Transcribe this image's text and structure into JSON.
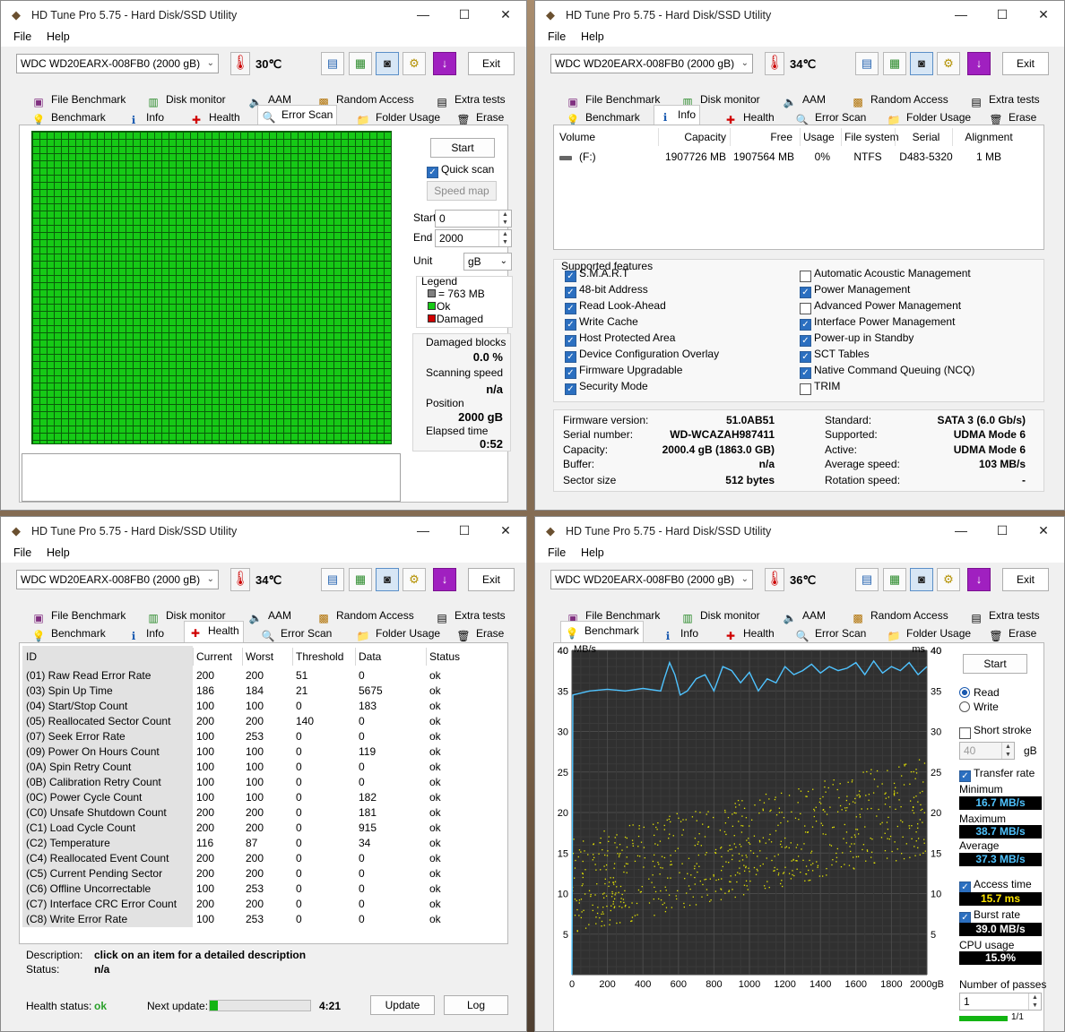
{
  "app": {
    "title": "HD Tune Pro 5.75 - Hard Disk/SSD Utility",
    "menu_file": "File",
    "menu_help": "Help",
    "exit_label": "Exit",
    "min": "—",
    "max": "☐",
    "close": "✕"
  },
  "drive": "WDC WD20EARX-008FB0 (2000 gB)",
  "temps": {
    "w1": "30℃",
    "w2": "34℃",
    "w3": "34℃",
    "w4": "36℃"
  },
  "tabs": {
    "file_benchmark": "File Benchmark",
    "disk_monitor": "Disk monitor",
    "aam": "AAM",
    "random_access": "Random Access",
    "extra_tests": "Extra tests",
    "benchmark": "Benchmark",
    "info": "Info",
    "health": "Health",
    "error_scan": "Error Scan",
    "folder_usage": "Folder Usage",
    "erase": "Erase"
  },
  "error_scan": {
    "start_btn": "Start",
    "quick_scan": "Quick scan",
    "speed_map": "Speed map",
    "start_label": "Start",
    "start_value": "0",
    "end_label": "End",
    "end_value": "2000",
    "unit_label": "Unit",
    "unit_value": "gB",
    "legend_title": "Legend",
    "legend_block": "= 763 MB",
    "legend_ok": "Ok",
    "legend_damaged": "Damaged",
    "damaged_label": "Damaged blocks",
    "damaged_value": "0.0 %",
    "scanning_label": "Scanning speed",
    "scanning_value": "n/a",
    "position_label": "Position",
    "position_value": "2000 gB",
    "elapsed_label": "Elapsed time",
    "elapsed_value": "0:52",
    "colors": {
      "ok": "#16c916",
      "damaged": "#d00000",
      "block": "#808080"
    }
  },
  "info": {
    "volume_headers": [
      "Volume",
      "Capacity",
      "Free",
      "Usage",
      "File system",
      "Serial",
      "Alignment"
    ],
    "volume_row": [
      "(F:)",
      "1907726 MB",
      "1907564 MB",
      "0%",
      "NTFS",
      "D483-5320",
      "1 MB"
    ],
    "supported_title": "Supported features",
    "features_left": [
      {
        "label": "S.M.A.R.T",
        "on": true
      },
      {
        "label": "48-bit Address",
        "on": true
      },
      {
        "label": "Read Look-Ahead",
        "on": true
      },
      {
        "label": "Write Cache",
        "on": true
      },
      {
        "label": "Host Protected Area",
        "on": true
      },
      {
        "label": "Device Configuration Overlay",
        "on": true
      },
      {
        "label": "Firmware Upgradable",
        "on": true
      },
      {
        "label": "Security Mode",
        "on": true
      }
    ],
    "features_right": [
      {
        "label": "Automatic Acoustic Management",
        "on": false
      },
      {
        "label": "Power Management",
        "on": true
      },
      {
        "label": "Advanced Power Management",
        "on": false
      },
      {
        "label": "Interface Power Management",
        "on": true
      },
      {
        "label": "Power-up in Standby",
        "on": true
      },
      {
        "label": "SCT Tables",
        "on": true
      },
      {
        "label": "Native Command Queuing (NCQ)",
        "on": true
      },
      {
        "label": "TRIM",
        "on": false
      }
    ],
    "details_left": [
      {
        "k": "Firmware version:",
        "v": "51.0AB51"
      },
      {
        "k": "Serial number:",
        "v": "WD-WCAZAH987411"
      },
      {
        "k": "Capacity:",
        "v": "2000.4 gB (1863.0 GB)"
      },
      {
        "k": "Buffer:",
        "v": "n/a"
      },
      {
        "k": "Sector size",
        "v": "512 bytes"
      }
    ],
    "details_right": [
      {
        "k": "Standard:",
        "v": "SATA 3 (6.0 Gb/s)"
      },
      {
        "k": "Supported:",
        "v": "UDMA Mode 6"
      },
      {
        "k": "Active:",
        "v": "UDMA Mode 6"
      },
      {
        "k": "Average speed:",
        "v": "103 MB/s"
      },
      {
        "k": "Rotation speed:",
        "v": "-"
      }
    ]
  },
  "health": {
    "headers": [
      "ID",
      "Current",
      "Worst",
      "Threshold",
      "Data",
      "Status"
    ],
    "rows": [
      [
        "(01) Raw Read Error Rate",
        "200",
        "200",
        "51",
        "0",
        "ok"
      ],
      [
        "(03) Spin Up Time",
        "186",
        "184",
        "21",
        "5675",
        "ok"
      ],
      [
        "(04) Start/Stop Count",
        "100",
        "100",
        "0",
        "183",
        "ok"
      ],
      [
        "(05) Reallocated Sector Count",
        "200",
        "200",
        "140",
        "0",
        "ok"
      ],
      [
        "(07) Seek Error Rate",
        "100",
        "253",
        "0",
        "0",
        "ok"
      ],
      [
        "(09) Power On Hours Count",
        "100",
        "100",
        "0",
        "119",
        "ok"
      ],
      [
        "(0A) Spin Retry Count",
        "100",
        "100",
        "0",
        "0",
        "ok"
      ],
      [
        "(0B) Calibration Retry Count",
        "100",
        "100",
        "0",
        "0",
        "ok"
      ],
      [
        "(0C) Power Cycle Count",
        "100",
        "100",
        "0",
        "182",
        "ok"
      ],
      [
        "(C0) Unsafe Shutdown Count",
        "200",
        "200",
        "0",
        "181",
        "ok"
      ],
      [
        "(C1) Load Cycle Count",
        "200",
        "200",
        "0",
        "915",
        "ok"
      ],
      [
        "(C2) Temperature",
        "116",
        "87",
        "0",
        "34",
        "ok"
      ],
      [
        "(C4) Reallocated Event Count",
        "200",
        "200",
        "0",
        "0",
        "ok"
      ],
      [
        "(C5) Current Pending Sector",
        "200",
        "200",
        "0",
        "0",
        "ok"
      ],
      [
        "(C6) Offline Uncorrectable",
        "100",
        "253",
        "0",
        "0",
        "ok"
      ],
      [
        "(C7) Interface CRC Error Count",
        "200",
        "200",
        "0",
        "0",
        "ok"
      ],
      [
        "(C8) Write Error Rate",
        "100",
        "253",
        "0",
        "0",
        "ok"
      ]
    ],
    "desc_label": "Description:",
    "desc_value": "click on an item for a detailed description",
    "status_label": "Status:",
    "status_value": "n/a",
    "health_label": "Health status:",
    "health_value": "ok",
    "next_label": "Next update:",
    "next_progress": 0.08,
    "next_time": "4:21",
    "update_btn": "Update",
    "log_btn": "Log"
  },
  "benchmark": {
    "start_btn": "Start",
    "read": "Read",
    "write": "Write",
    "short_stroke": "Short stroke",
    "stroke_value": "40",
    "stroke_unit": "gB",
    "transfer_rate": "Transfer rate",
    "min_label": "Minimum",
    "min_value": "16.7 MB/s",
    "max_label": "Maximum",
    "max_value": "38.7 MB/s",
    "avg_label": "Average",
    "avg_value": "37.3 MB/s",
    "access_label": "Access time",
    "access_value": "15.7 ms",
    "burst_label": "Burst rate",
    "burst_value": "39.0 MB/s",
    "cpu_label": "CPU usage",
    "cpu_value": "15.9%",
    "passes_label": "Number of passes",
    "passes_value": "1",
    "passes_progress": "1/1"
  },
  "chart_data": {
    "type": "line",
    "xlabel": "",
    "ylabel_left": "MB/s",
    "ylabel_right": "ms",
    "x_ticks": [
      "0",
      "200",
      "400",
      "600",
      "800",
      "1000",
      "1200",
      "1400",
      "1600",
      "1800",
      "2000gB"
    ],
    "y_ticks": [
      "5",
      "10",
      "15",
      "20",
      "25",
      "30",
      "35",
      "40"
    ],
    "xlim": [
      0,
      2000
    ],
    "ylim": [
      0,
      40
    ],
    "series": [
      {
        "values": [
          [
            0,
            0
          ],
          [
            5,
            34.5
          ],
          [
            100,
            35
          ],
          [
            200,
            35.2
          ],
          [
            300,
            35
          ],
          [
            400,
            35.3
          ],
          [
            500,
            35
          ],
          [
            520,
            36.5
          ],
          [
            550,
            38.5
          ],
          [
            580,
            37
          ],
          [
            610,
            34.5
          ],
          [
            650,
            35
          ],
          [
            700,
            36.5
          ],
          [
            750,
            37
          ],
          [
            800,
            35
          ],
          [
            850,
            38
          ],
          [
            900,
            37.5
          ],
          [
            950,
            36
          ],
          [
            1000,
            37.3
          ],
          [
            1050,
            35
          ],
          [
            1100,
            36.5
          ],
          [
            1150,
            36
          ],
          [
            1200,
            38
          ],
          [
            1250,
            37
          ],
          [
            1300,
            37.5
          ],
          [
            1350,
            38.3
          ],
          [
            1400,
            37.2
          ],
          [
            1450,
            38
          ],
          [
            1500,
            37.5
          ],
          [
            1550,
            37.8
          ],
          [
            1600,
            38.5
          ],
          [
            1650,
            37
          ],
          [
            1700,
            38.7
          ],
          [
            1750,
            37.2
          ],
          [
            1800,
            38
          ],
          [
            1850,
            37.5
          ],
          [
            1900,
            38.5
          ],
          [
            1950,
            37
          ],
          [
            2000,
            38
          ]
        ],
        "color": "#4fc3ff"
      }
    ],
    "scatter_color": "#e8e800"
  }
}
